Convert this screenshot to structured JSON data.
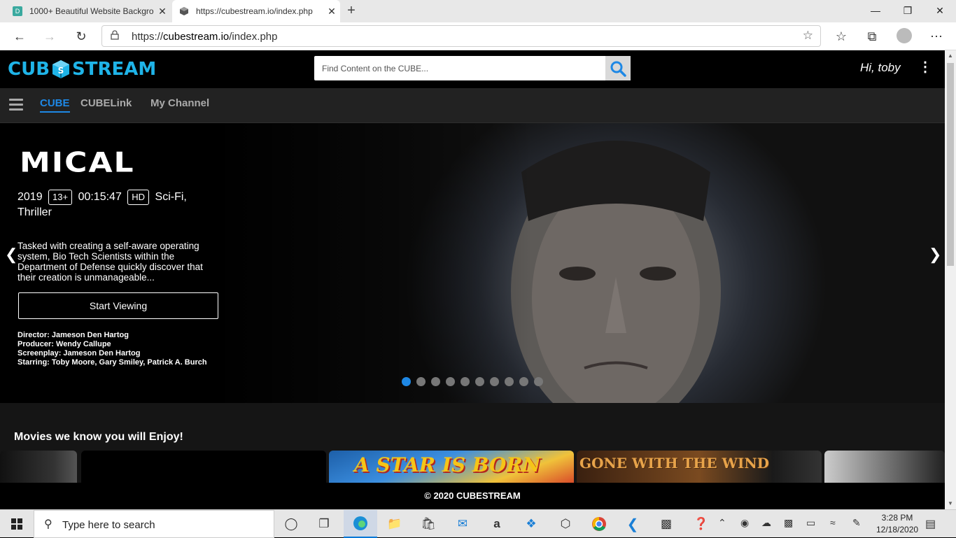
{
  "browser": {
    "tabs": [
      {
        "title": "1000+ Beautiful Website Backgro",
        "favicon": "D"
      },
      {
        "title": "https://cubestream.io/index.php"
      }
    ],
    "url_scheme": "https://",
    "url_host": "cubestream.io",
    "url_path": "/index.php",
    "new_tab_glyph": "+",
    "close_glyph": "✕"
  },
  "site": {
    "logo_left": "CUB",
    "logo_right": "STREAM",
    "search_placeholder": "Find Content on the CUBE...",
    "greeting": "Hi, toby",
    "nav": [
      {
        "label": "CUBE",
        "active": true
      },
      {
        "label": "CUBELink",
        "active": false
      },
      {
        "label": "My Channel",
        "active": false
      }
    ]
  },
  "hero": {
    "title": "MICAL",
    "year": "2019",
    "rating": "13+",
    "runtime": "00:15:47",
    "quality": "HD",
    "genres": "Sci-Fi, Thriller",
    "description": "Tasked with creating a self-aware operating system, Bio Tech Scientists within the Department of Defense quickly discover that their creation is unmanageable...",
    "cta": "Start Viewing",
    "credits": [
      "Director: Jameson Den Hartog",
      "Producer: Wendy Callupe",
      "Screenplay: Jameson Den Hartog",
      "Starring: Toby Moore, Gary Smiley, Patrick A. Burch"
    ],
    "slide_count": 10,
    "active_slide": 1
  },
  "section": {
    "title": "Movies we know you will Enjoy!",
    "cards": [
      {
        "text": ""
      },
      {
        "text": ""
      },
      {
        "text": "A STAR IS BORN"
      },
      {
        "text": "GONE WITH THE WIND"
      },
      {
        "text": ""
      }
    ]
  },
  "footer": {
    "text": "© 2020 CUBESTREAM"
  },
  "taskbar": {
    "search_placeholder": "Type here to search",
    "time": "3:28 PM",
    "date": "12/18/2020"
  },
  "colors": {
    "accent": "#1e88e5",
    "logo": "#1fb4e8",
    "nav_bg": "#222222"
  }
}
